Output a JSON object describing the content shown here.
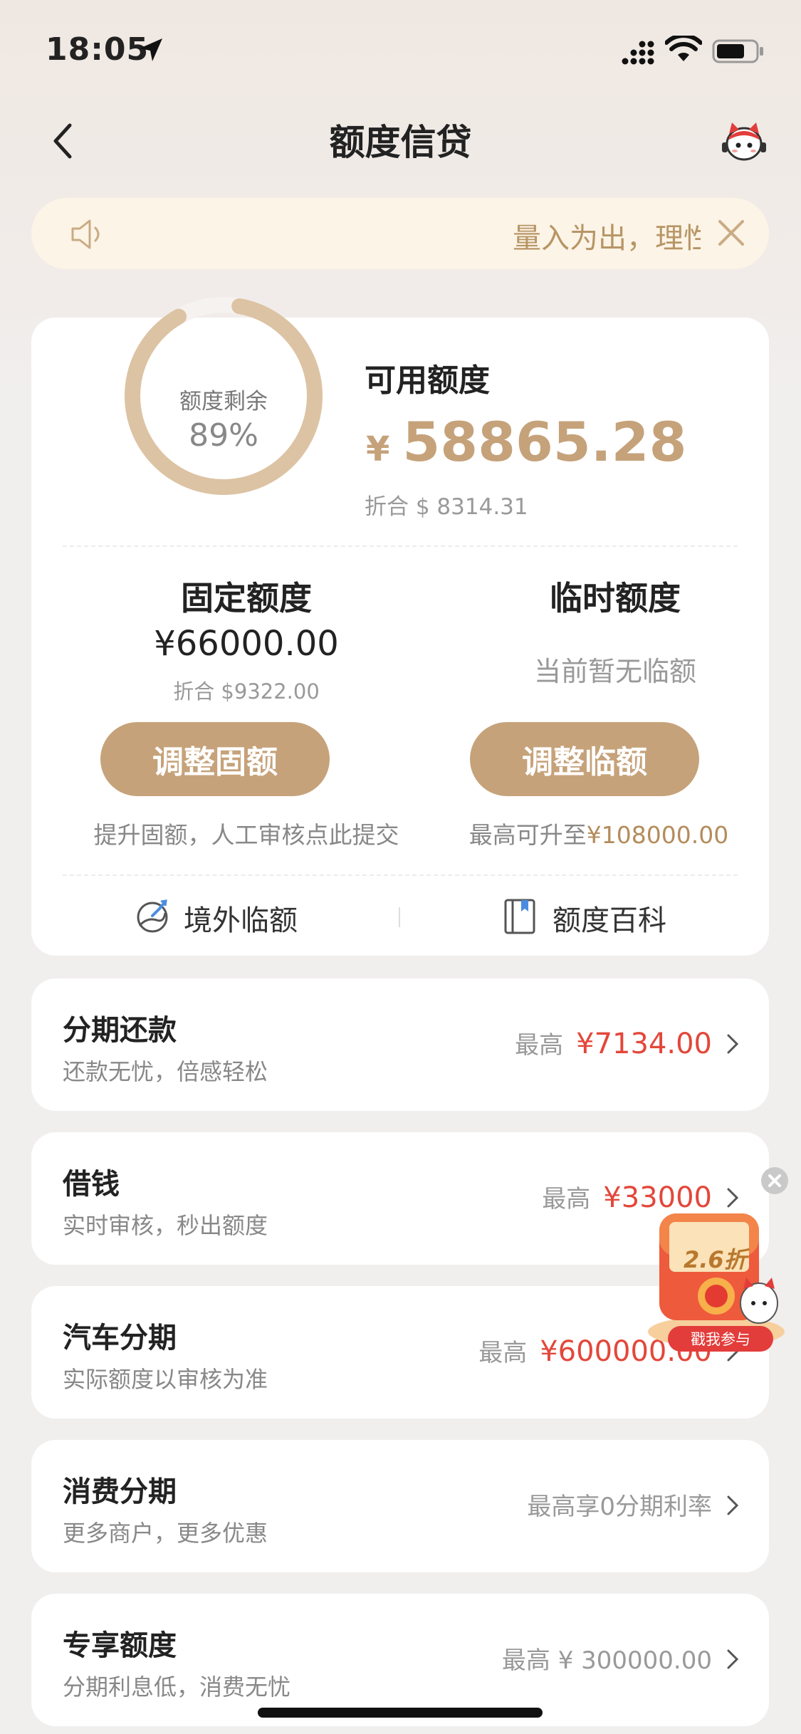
{
  "status_bar": {
    "time": "18:05"
  },
  "nav": {
    "title": "额度信贷"
  },
  "notice": {
    "text": "量入为出，理性消费"
  },
  "credit": {
    "ring_label": "额度剩余",
    "ring_percent_text": "89%",
    "ring_fraction": 0.89,
    "available_label": "可用额度",
    "available_currency": "¥",
    "available_amount": "58865.28",
    "available_converted": "折合 $ 8314.31",
    "fixed": {
      "title": "固定额度",
      "amount": "¥66000.00",
      "converted": "折合 $9322.00",
      "button": "调整固额",
      "hint": "提升固额，人工审核点此提交"
    },
    "temporary": {
      "title": "临时额度",
      "status": "当前暂无临额",
      "button": "调整临额",
      "hint_prefix": "最高可升至",
      "hint_value": "¥108000.00"
    },
    "links": {
      "overseas": "境外临额",
      "wiki": "额度百科"
    }
  },
  "products": [
    {
      "title": "分期还款",
      "subtitle": "还款无忧，倍感轻松",
      "prefix": "最高",
      "value": "¥7134.00"
    },
    {
      "title": "借钱",
      "subtitle": "实时审核，秒出额度",
      "prefix": "最高",
      "value": "¥33000"
    },
    {
      "title": "汽车分期",
      "subtitle": "实际额度以审核为准",
      "prefix": "最高",
      "value": "¥600000.00"
    },
    {
      "title": "消费分期",
      "subtitle": "更多商户，更多优惠",
      "prefix": "",
      "value": "最高享0分期利率"
    },
    {
      "title": "专享额度",
      "subtitle": "分期利息低，消费无忧",
      "prefix": "",
      "value": "最高 ¥ 300000.00"
    }
  ],
  "promo": {
    "discount": "2.6折",
    "button": "戳我参与"
  },
  "colors": {
    "gold": "#c6a27a",
    "red": "#e3473a",
    "notice_bg": "#fcf4e6"
  },
  "icons": [
    "location-arrow-icon",
    "signal-icon",
    "wifi-icon",
    "battery-icon",
    "back-icon",
    "mascot-avatar-icon",
    "speaker-icon",
    "close-icon",
    "overseas-icon",
    "book-icon",
    "chevron-right-icon"
  ]
}
